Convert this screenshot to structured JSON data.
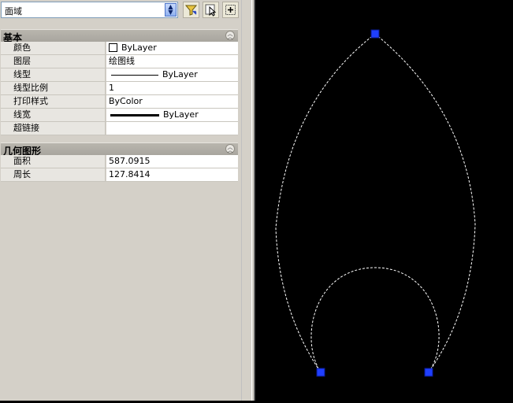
{
  "toolbar": {
    "object_type": "面域",
    "icons": [
      "quick-select-icon",
      "select-objects-icon",
      "pickadd-toggle-icon"
    ]
  },
  "sections": {
    "general": {
      "title": "基本",
      "rows": [
        {
          "name": "颜色",
          "value": "ByLayer"
        },
        {
          "name": "图层",
          "value": "绘图线"
        },
        {
          "name": "线型",
          "value": "ByLayer"
        },
        {
          "name": "线型比例",
          "value": "1"
        },
        {
          "name": "打印样式",
          "value": "ByColor"
        },
        {
          "name": "线宽",
          "value": "ByLayer"
        },
        {
          "name": "超链接",
          "value": ""
        }
      ]
    },
    "geometry": {
      "title": "几何图形",
      "rows": [
        {
          "name": "面积",
          "value": "587.0915"
        },
        {
          "name": "周长",
          "value": "127.8414"
        }
      ]
    }
  },
  "canvas": {
    "background": "#000000",
    "outline_color": "#ffffff",
    "grip_color": "#1f3fff"
  }
}
